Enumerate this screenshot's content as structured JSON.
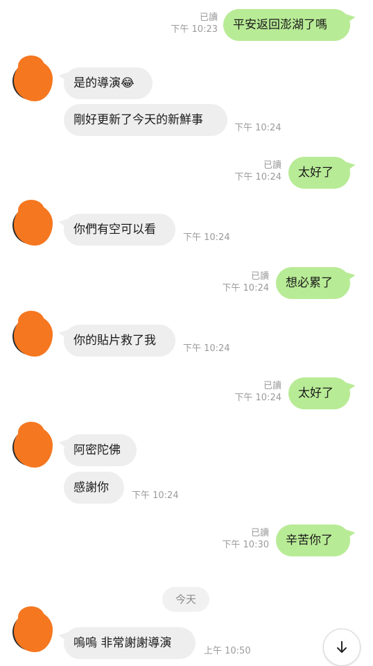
{
  "chat": {
    "day_divider": "今天",
    "messages": [
      {
        "dir": "out",
        "text": "平安返回澎湖了嗎",
        "read": "已讀",
        "time": "下午 10:23"
      },
      {
        "dir": "in",
        "text": "是的導演😂"
      },
      {
        "dir": "in",
        "text": "剛好更新了今天的新鮮事",
        "time": "下午 10:24"
      },
      {
        "dir": "out",
        "text": "太好了",
        "read": "已讀",
        "time": "下午 10:24"
      },
      {
        "dir": "in",
        "text": "你們有空可以看",
        "time": "下午 10:24"
      },
      {
        "dir": "out",
        "text": "想必累了",
        "read": "已讀",
        "time": "下午 10:24"
      },
      {
        "dir": "in",
        "text": "你的貼片救了我",
        "time": "下午 10:24"
      },
      {
        "dir": "out",
        "text": "太好了",
        "read": "已讀",
        "time": "下午 10:24"
      },
      {
        "dir": "in",
        "text": "阿密陀佛"
      },
      {
        "dir": "in",
        "text": "感謝你",
        "time": "下午 10:24"
      },
      {
        "dir": "out",
        "text": "辛苦你了",
        "read": "已讀",
        "time": "下午 10:30"
      },
      {
        "dir": "in",
        "text": "嗚嗚  非常謝謝導演",
        "time": "上午 10:50"
      }
    ]
  },
  "icons": {
    "scroll_down": "arrow-down-icon",
    "avatar": "avatar-obscured"
  },
  "colors": {
    "outgoing_bubble": "#b8eb96",
    "incoming_bubble": "#eeeeee",
    "avatar_mask": "#f57720",
    "meta_text": "#9a9a9a"
  }
}
